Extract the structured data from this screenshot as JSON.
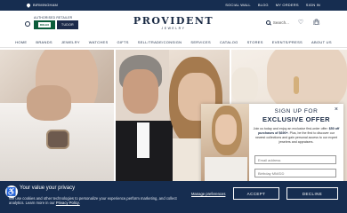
{
  "topbar": {
    "location": "BIRMINGHAM",
    "links": [
      "SOCIAL WALL",
      "BLOG",
      "MY ORDERS",
      "SIGN IN"
    ]
  },
  "header": {
    "authorized_label": "AUTHORISED RETAILER",
    "rolex_badge": "ROLEX",
    "tudor_badge": "TUDOR",
    "brand": "PROVIDENT",
    "brand_sub": "JEWELRY",
    "search_placeholder": "Search..."
  },
  "nav": [
    "HOME",
    "BRANDS",
    "JEWELRY",
    "WATCHES",
    "GIFTS",
    "SELL/TRADE/CONSIGN",
    "SERVICES",
    "CATALOG",
    "STORES",
    "EVENTS/PRESS",
    "ABOUT US"
  ],
  "offer": {
    "close": "×",
    "title_line1": "SIGN UP FOR",
    "title_line2": "EXCLUSIVE OFFER",
    "desc_pre": "Join us today and enjoy an exclusive first-order offer:",
    "desc_bold": "$50 off purchases of $690+.",
    "desc_post": "Plus, be the first to discover our newest collections and gain personal access to our expert jewelers and appraisers.",
    "email_placeholder": "Email address",
    "birthday_placeholder": "Birthday MM/DD"
  },
  "cookie": {
    "icon": "♿",
    "title": "Your value your privacy",
    "message_pre": "We use cookies and other technologies to personalize your experience,perform marketing, and collect analytics. Learn more in our",
    "privacy_link": "Privacy Policy.",
    "manage": "Manage preferences",
    "accept": "ACCEPT",
    "decline": "DECLINE"
  },
  "colors": {
    "navy": "#162d50",
    "text": "#1a2a44",
    "rolex_green": "#0b5c3a"
  },
  "icons": [
    "location-pin-icon",
    "globe-icon",
    "search-icon",
    "heart-icon",
    "bag-icon",
    "close-icon",
    "accessibility-icon"
  ]
}
